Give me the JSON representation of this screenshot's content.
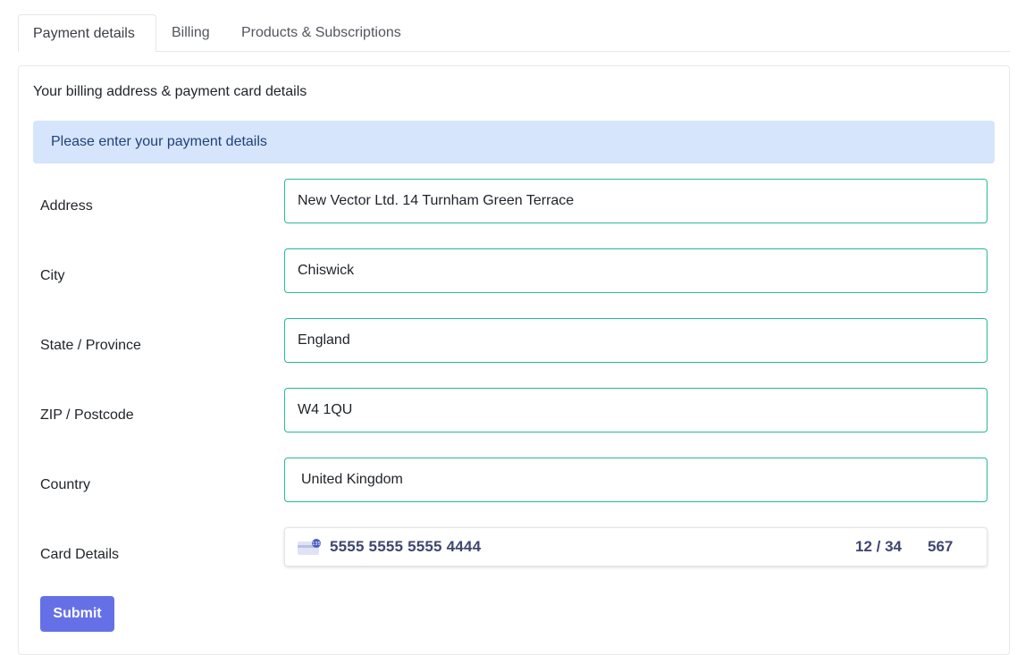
{
  "tabs": [
    {
      "label": "Payment details",
      "active": true
    },
    {
      "label": "Billing",
      "active": false
    },
    {
      "label": "Products & Subscriptions",
      "active": false
    }
  ],
  "card": {
    "title": "Your billing address & payment card details",
    "alert": "Please enter your payment details"
  },
  "form": {
    "address": {
      "label": "Address",
      "value": "New Vector Ltd. 14 Turnham Green Terrace"
    },
    "city": {
      "label": "City",
      "value": "Chiswick"
    },
    "state": {
      "label": "State / Province",
      "value": "England"
    },
    "zip": {
      "label": "ZIP / Postcode",
      "value": "W4 1QU"
    },
    "country": {
      "label": "Country",
      "value": "United Kingdom"
    },
    "card_details": {
      "label": "Card Details",
      "icon": "credit-card-icon",
      "icon_badge": "135",
      "number": "5555 5555 5555 4444",
      "expiry": "12 / 34",
      "cvc": "567"
    },
    "submit_label": "Submit"
  },
  "colors": {
    "accent": "#6670e6",
    "field_border": "#26b89a",
    "alert_bg": "#d6e5fc",
    "alert_text": "#1e4278"
  }
}
